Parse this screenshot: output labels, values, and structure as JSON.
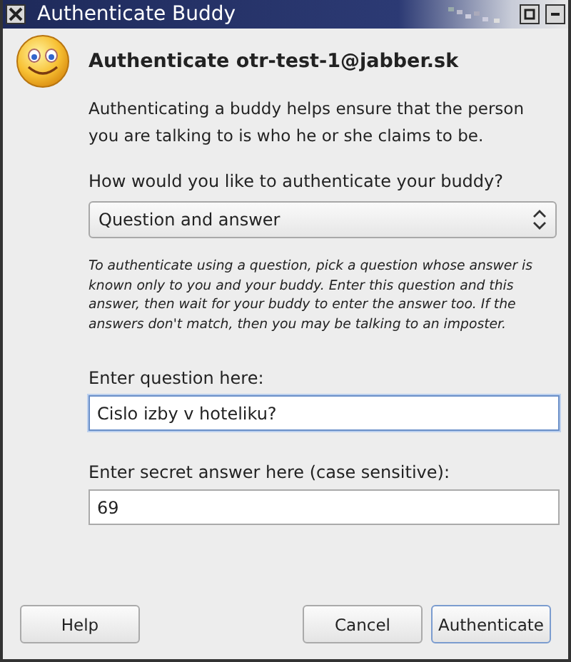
{
  "window": {
    "title": "Authenticate Buddy"
  },
  "heading": "Authenticate otr-test-1@jabber.sk",
  "intro": "Authenticating a buddy helps ensure that the person you are talking to is who he or she claims to be.",
  "method": {
    "label": "How would you like to authenticate your buddy?",
    "value": "Question and answer"
  },
  "instructions": "To authenticate using a question, pick a question whose answer is known only to you and your buddy.  Enter this question and this answer, then wait for your buddy to enter the answer too.  If the answers don't match, then you may be talking to an imposter.",
  "question": {
    "label": "Enter question here:",
    "value": "Cislo izby v hoteliku?",
    "focused": true
  },
  "answer": {
    "label": "Enter secret answer here (case sensitive):",
    "value": "69",
    "focused": false
  },
  "buttons": [
    {
      "label": "Help",
      "default": false
    },
    {
      "label": "Cancel",
      "default": false
    },
    {
      "label": "Authenticate",
      "default": true
    }
  ]
}
